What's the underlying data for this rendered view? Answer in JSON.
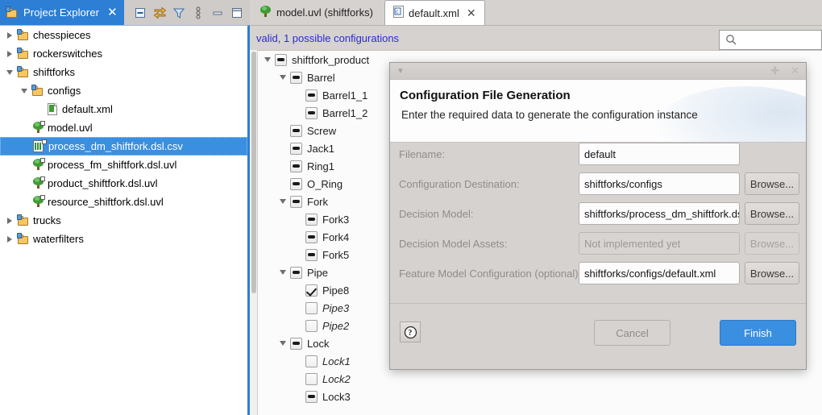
{
  "explorer": {
    "tab_label": "Project Explorer",
    "tab_close": "✕",
    "toolbar": [
      {
        "name": "collapse-all-icon",
        "title": "Collapse All"
      },
      {
        "name": "link-with-editor-icon",
        "title": "Link with Editor"
      },
      {
        "name": "filter-icon",
        "title": "Filters"
      },
      {
        "name": "view-menu-icon",
        "title": "View Menu"
      },
      {
        "name": "minimize-icon",
        "title": "Minimize"
      },
      {
        "name": "maximize-icon",
        "title": "Maximize"
      }
    ],
    "tree": [
      {
        "label": "chesspieces",
        "indent": 0,
        "twist": "closed",
        "icon": "project-folder",
        "selected": false
      },
      {
        "label": "rockerswitches",
        "indent": 0,
        "twist": "closed",
        "icon": "project-folder",
        "selected": false
      },
      {
        "label": "shiftforks",
        "indent": 0,
        "twist": "open",
        "icon": "project-folder",
        "selected": false
      },
      {
        "label": "configs",
        "indent": 1,
        "twist": "open",
        "icon": "project-folder",
        "selected": false
      },
      {
        "label": "default.xml",
        "indent": 2,
        "twist": "none",
        "icon": "xml-file",
        "selected": false
      },
      {
        "label": "model.uvl",
        "indent": 1,
        "twist": "none",
        "icon": "uvl-file",
        "selected": false
      },
      {
        "label": "process_dm_shiftfork.dsl.csv",
        "indent": 1,
        "twist": "none",
        "icon": "csv-file",
        "selected": true
      },
      {
        "label": "process_fm_shiftfork.dsl.uvl",
        "indent": 1,
        "twist": "none",
        "icon": "uvl-file",
        "selected": false
      },
      {
        "label": "product_shiftfork.dsl.uvl",
        "indent": 1,
        "twist": "none",
        "icon": "uvl-file",
        "selected": false
      },
      {
        "label": "resource_shiftfork.dsl.uvl",
        "indent": 1,
        "twist": "none",
        "icon": "uvl-file",
        "selected": false
      },
      {
        "label": "trucks",
        "indent": 0,
        "twist": "closed",
        "icon": "project-folder",
        "selected": false
      },
      {
        "label": "waterfilters",
        "indent": 0,
        "twist": "closed",
        "icon": "project-folder",
        "selected": false
      }
    ]
  },
  "editor": {
    "tabs": [
      {
        "label": "model.uvl (shiftforks)",
        "active": false,
        "icon": "uvl-file-icon",
        "closable": false
      },
      {
        "label": "default.xml",
        "active": true,
        "icon": "xml-file-icon",
        "closable": true,
        "close": "✕"
      }
    ],
    "status_text": "valid, 1 possible configurations",
    "search_placeholder": "",
    "search_value": "",
    "feature_tree": [
      {
        "label": "shiftfork_product",
        "indent": 0,
        "twist": "open",
        "state": "dash",
        "italic": false
      },
      {
        "label": "Barrel",
        "indent": 1,
        "twist": "open",
        "state": "dash",
        "italic": false
      },
      {
        "label": "Barrel1_1",
        "indent": 2,
        "twist": "none",
        "state": "dash",
        "italic": false
      },
      {
        "label": "Barrel1_2",
        "indent": 2,
        "twist": "none",
        "state": "dash",
        "italic": false
      },
      {
        "label": "Screw",
        "indent": 1,
        "twist": "none",
        "state": "dash",
        "italic": false
      },
      {
        "label": "Jack1",
        "indent": 1,
        "twist": "none",
        "state": "dash",
        "italic": false
      },
      {
        "label": "Ring1",
        "indent": 1,
        "twist": "none",
        "state": "dash",
        "italic": false
      },
      {
        "label": "O_Ring",
        "indent": 1,
        "twist": "none",
        "state": "dash",
        "italic": false
      },
      {
        "label": "Fork",
        "indent": 1,
        "twist": "open",
        "state": "dash",
        "italic": false
      },
      {
        "label": "Fork3",
        "indent": 2,
        "twist": "none",
        "state": "dash",
        "italic": false
      },
      {
        "label": "Fork4",
        "indent": 2,
        "twist": "none",
        "state": "dash",
        "italic": false
      },
      {
        "label": "Fork5",
        "indent": 2,
        "twist": "none",
        "state": "dash",
        "italic": false
      },
      {
        "label": "Pipe",
        "indent": 1,
        "twist": "open",
        "state": "dash",
        "italic": false
      },
      {
        "label": "Pipe8",
        "indent": 2,
        "twist": "none",
        "state": "check",
        "italic": false
      },
      {
        "label": "Pipe3",
        "indent": 2,
        "twist": "none",
        "state": "empty",
        "italic": true
      },
      {
        "label": "Pipe2",
        "indent": 2,
        "twist": "none",
        "state": "empty",
        "italic": true
      },
      {
        "label": "Lock",
        "indent": 1,
        "twist": "open",
        "state": "dash",
        "italic": false
      },
      {
        "label": "Lock1",
        "indent": 2,
        "twist": "none",
        "state": "empty",
        "italic": true
      },
      {
        "label": "Lock2",
        "indent": 2,
        "twist": "none",
        "state": "empty",
        "italic": true
      },
      {
        "label": "Lock3",
        "indent": 2,
        "twist": "none",
        "state": "dash",
        "italic": false
      }
    ]
  },
  "dialog": {
    "window_maximize": "✚",
    "window_close": "✕",
    "title": "Configuration File Generation",
    "subtitle": "Enter the required data to generate the configuration instance",
    "fields": [
      {
        "label": "Filename:",
        "value": "default",
        "placeholder": "",
        "disabled": false,
        "has_browse": false,
        "browse_label": "Browse...",
        "browse_disabled": false
      },
      {
        "label": "Configuration Destination:",
        "value": "shiftforks/configs",
        "placeholder": "",
        "disabled": false,
        "has_browse": true,
        "browse_label": "Browse...",
        "browse_disabled": false
      },
      {
        "label": "Decision Model:",
        "value": "shiftforks/process_dm_shiftfork.ds",
        "placeholder": "",
        "disabled": false,
        "has_browse": true,
        "browse_label": "Browse...",
        "browse_disabled": false
      },
      {
        "label": "Decision Model Assets:",
        "value": "",
        "placeholder": "Not implemented yet",
        "disabled": true,
        "has_browse": true,
        "browse_label": "Browse...",
        "browse_disabled": true
      },
      {
        "label": "Feature Model Configuration (optional):",
        "value": "shiftforks/configs/default.xml",
        "placeholder": "",
        "disabled": false,
        "has_browse": true,
        "browse_label": "Browse...",
        "browse_disabled": false
      }
    ],
    "help_label": "?",
    "cancel_label": "Cancel",
    "finish_label": "Finish",
    "accent_color": "#3b8fe0"
  }
}
